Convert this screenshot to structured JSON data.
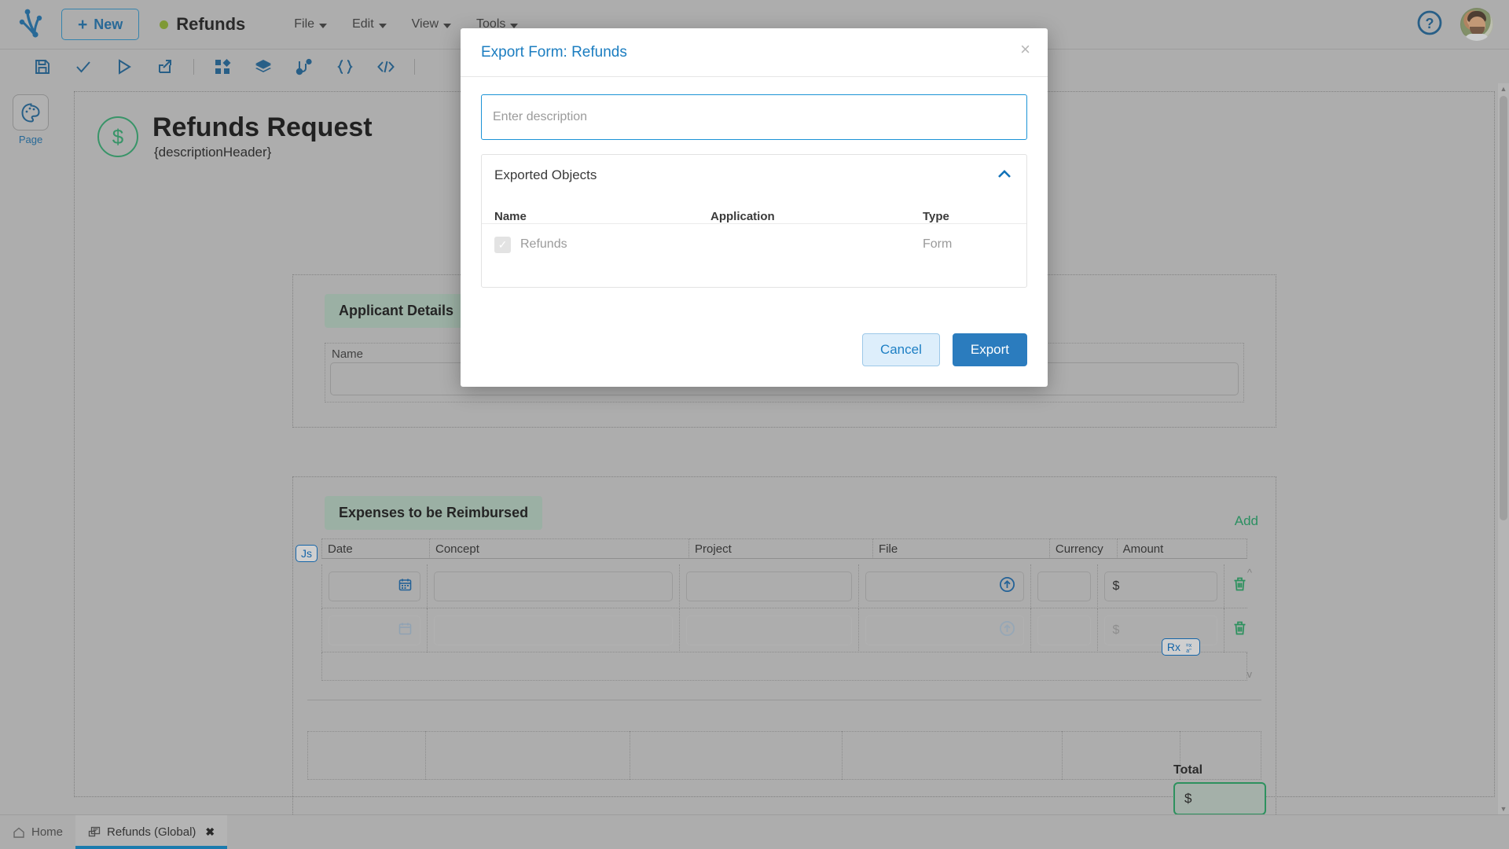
{
  "topbar": {
    "logo_icon": "company-logo-icon",
    "new_button": "New",
    "app_name": "Refunds",
    "menus": [
      {
        "label": "File",
        "icon": "chevron-down-icon"
      },
      {
        "label": "Edit",
        "icon": "chevron-down-icon"
      },
      {
        "label": "View",
        "icon": "chevron-down-icon"
      },
      {
        "label": "Tools",
        "icon": "chevron-down-icon"
      }
    ],
    "help_icon": "help-question-icon",
    "avatar_icon": "user-avatar"
  },
  "toolbar": {
    "icons": [
      "save-icon",
      "validate-check-icon",
      "run-play-icon",
      "deploy-share-icon",
      "components-icon",
      "layers-icon",
      "connections-icon",
      "json-braces-icon",
      "code-brackets-icon"
    ]
  },
  "rail": {
    "page_label": "Page",
    "page_icon": "palette-icon"
  },
  "form": {
    "title": "Refunds Request",
    "subtitle": "{descriptionHeader}",
    "icon": "dollar-circle-icon",
    "sections": [
      {
        "id": "applicant",
        "header": "Applicant Details",
        "field_label": "Name"
      },
      {
        "id": "expenses",
        "header": "Expenses to be Reimbursed",
        "add_label": "Add"
      }
    ],
    "grid": {
      "columns": [
        "Date",
        "Concept",
        "Project",
        "File",
        "Currency",
        "Amount"
      ],
      "rows": [
        {
          "date": "",
          "concept": "",
          "project": "",
          "file": "",
          "currency": "",
          "amount": "$",
          "faded": false
        },
        {
          "date": "",
          "concept": "",
          "project": "",
          "file": "",
          "currency": "",
          "amount": "$",
          "faded": true
        }
      ],
      "date_icon": "calendar-icon",
      "upload_icon": "upload-circle-icon",
      "delete_icon": "trash-icon"
    },
    "badges": [
      {
        "id": "js",
        "label": "Js",
        "icon": "javascript-badge-icon"
      },
      {
        "id": "rx",
        "label": "Rx",
        "icon": "formula-badge-icon"
      }
    ],
    "total": {
      "label": "Total",
      "value": "$"
    }
  },
  "modal": {
    "title": "Export Form: Refunds",
    "close_icon": "close-icon",
    "description_placeholder": "Enter description",
    "description_value": "",
    "objects_panel": {
      "title": "Exported Objects",
      "collapse_icon": "chevron-up-icon",
      "columns": [
        "Name",
        "Application",
        "Type"
      ],
      "rows": [
        {
          "name": "Refunds",
          "application": "",
          "type": "Form",
          "checked": true,
          "disabled": true
        }
      ]
    },
    "cancel_label": "Cancel",
    "export_label": "Export"
  },
  "bottom_tabs": [
    {
      "label": "Home",
      "icon": "home-icon",
      "active": false,
      "closable": false
    },
    {
      "label": "Refunds (Global)",
      "icon": "form-document-icon",
      "active": true,
      "closable": true,
      "close_label": "✖"
    }
  ],
  "colors": {
    "accent_blue": "#1b7dc0",
    "primary_button": "#2b7cbe",
    "section_header_green": "#aec8b9",
    "success_green": "#21a05f",
    "chrome_gray": "#c4c4c4",
    "status_dot": "#8aab2c"
  }
}
